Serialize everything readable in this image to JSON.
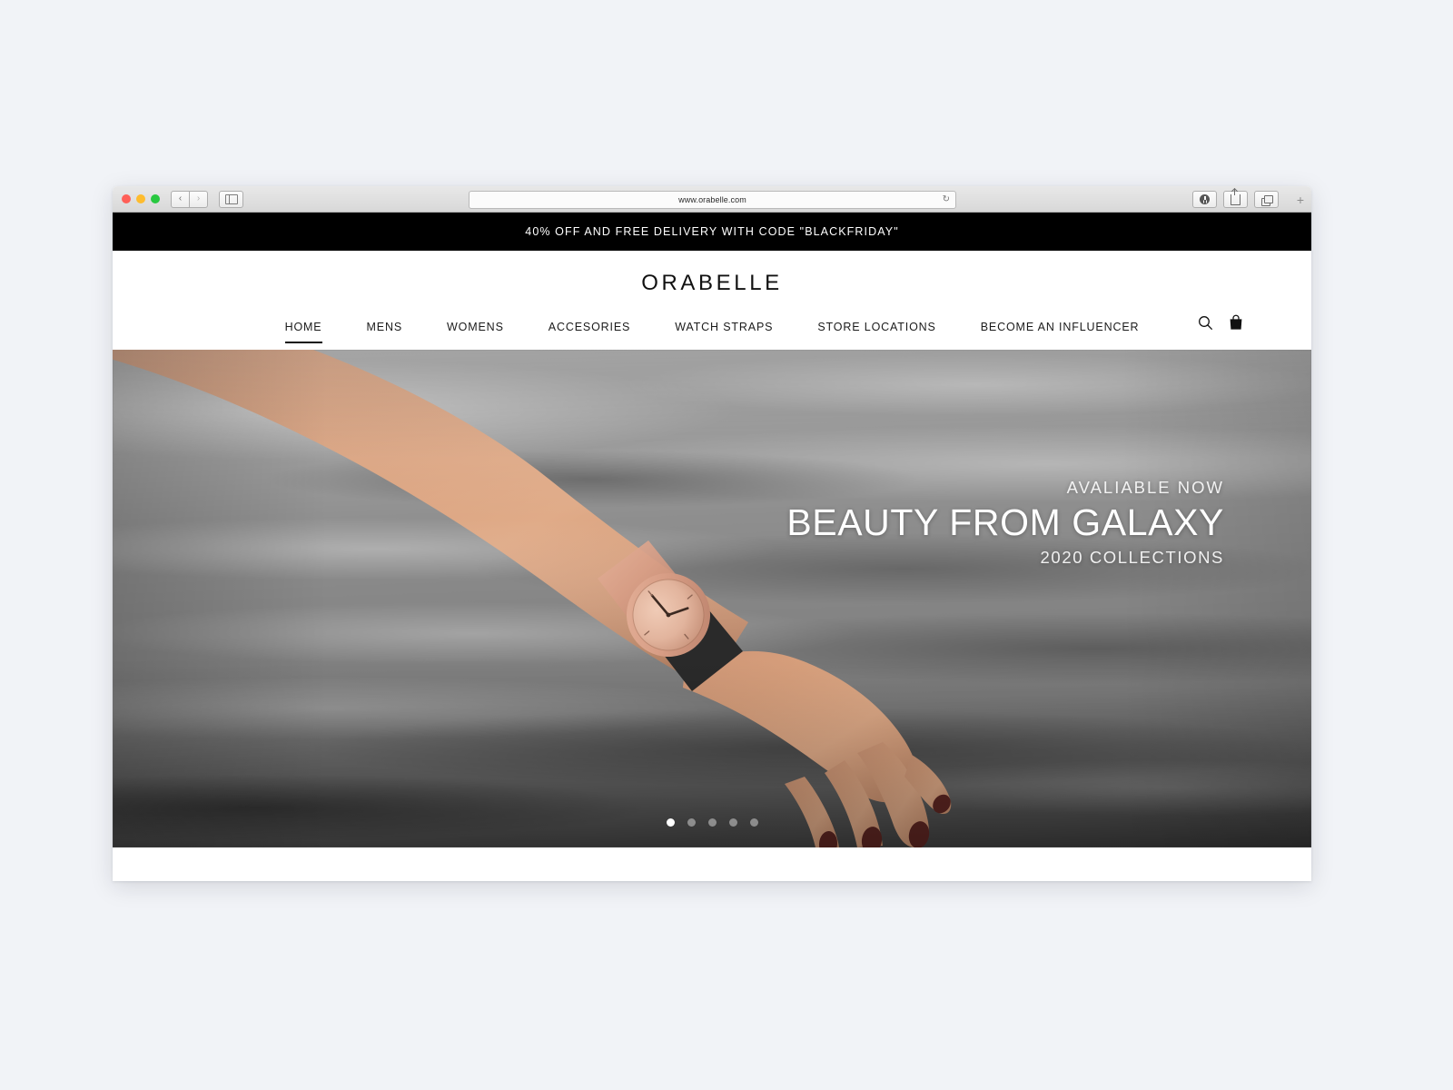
{
  "browser": {
    "traffic_lights": [
      "close",
      "minimize",
      "zoom"
    ],
    "back_label": "‹",
    "forward_label": "›",
    "sidebar_icon": "sidebar-icon",
    "url": "www.orabelle.com",
    "reload_icon": "↻",
    "toolbar_icons": [
      "download-icon",
      "share-icon",
      "tab-overview-icon"
    ],
    "new_tab_label": "+"
  },
  "promo": {
    "text": "40% OFF AND FREE DELIVERY WITH CODE \"BLACKFRIDAY\""
  },
  "header": {
    "brand": "ORABELLE",
    "nav": [
      {
        "label": "HOME",
        "active": true
      },
      {
        "label": "MENS",
        "active": false
      },
      {
        "label": "WOMENS",
        "active": false
      },
      {
        "label": "ACCESORIES",
        "active": false
      },
      {
        "label": "WATCH STRAPS",
        "active": false
      },
      {
        "label": "STORE LOCATIONS",
        "active": false
      },
      {
        "label": "BECOME AN INFLUENCER",
        "active": false
      }
    ],
    "icons": [
      {
        "name": "search-icon"
      },
      {
        "name": "shopping-bag-icon"
      }
    ]
  },
  "hero": {
    "kicker": "AVALIABLE NOW",
    "title": "BEAUTY FROM GALAXY",
    "subtitle": "2020 COLLECTIONS",
    "image_alt": "woman's arm wearing a rose-gold wristwatch above rippling water",
    "carousel": {
      "count": 5,
      "active_index": 0
    }
  },
  "colors": {
    "promo_bg": "#000000",
    "page_bg": "#f1f3f7",
    "text": "#111111",
    "hero_text": "#ffffff"
  }
}
